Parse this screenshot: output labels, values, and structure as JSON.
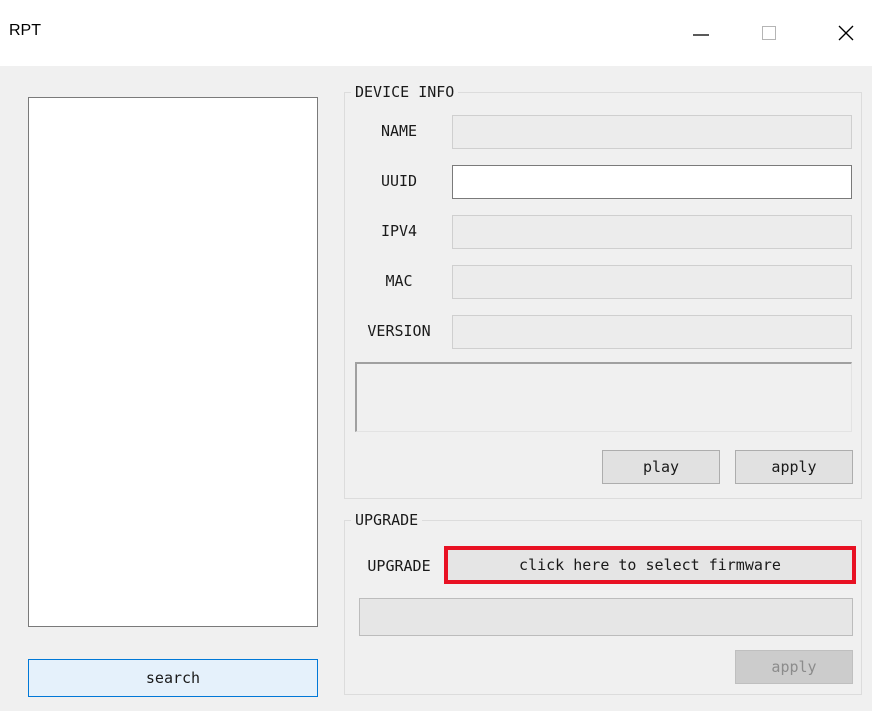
{
  "window": {
    "title": "RPT",
    "controls": [
      {
        "name": "minimize",
        "icon": "minimize-icon"
      },
      {
        "name": "maximize",
        "icon": "maximize-icon"
      },
      {
        "name": "close",
        "icon": "close-icon"
      }
    ]
  },
  "left_panel": {
    "search_label": "search"
  },
  "device_info": {
    "group_title": "DEVICE INFO",
    "fields": [
      {
        "label": "NAME",
        "value": "",
        "active": false
      },
      {
        "label": "UUID",
        "value": "",
        "active": true
      },
      {
        "label": "IPV4",
        "value": "",
        "active": false
      },
      {
        "label": "MAC",
        "value": "",
        "active": false
      },
      {
        "label": "VERSION",
        "value": "",
        "active": false
      }
    ],
    "log_text": "",
    "play_label": "play",
    "apply_label": "apply"
  },
  "upgrade": {
    "group_title": "UPGRADE",
    "row_label": "UPGRADE",
    "select_firmware_label": "click here to select firmware",
    "highlight_color": "#e81123",
    "progress": 0,
    "apply_label": "apply"
  }
}
